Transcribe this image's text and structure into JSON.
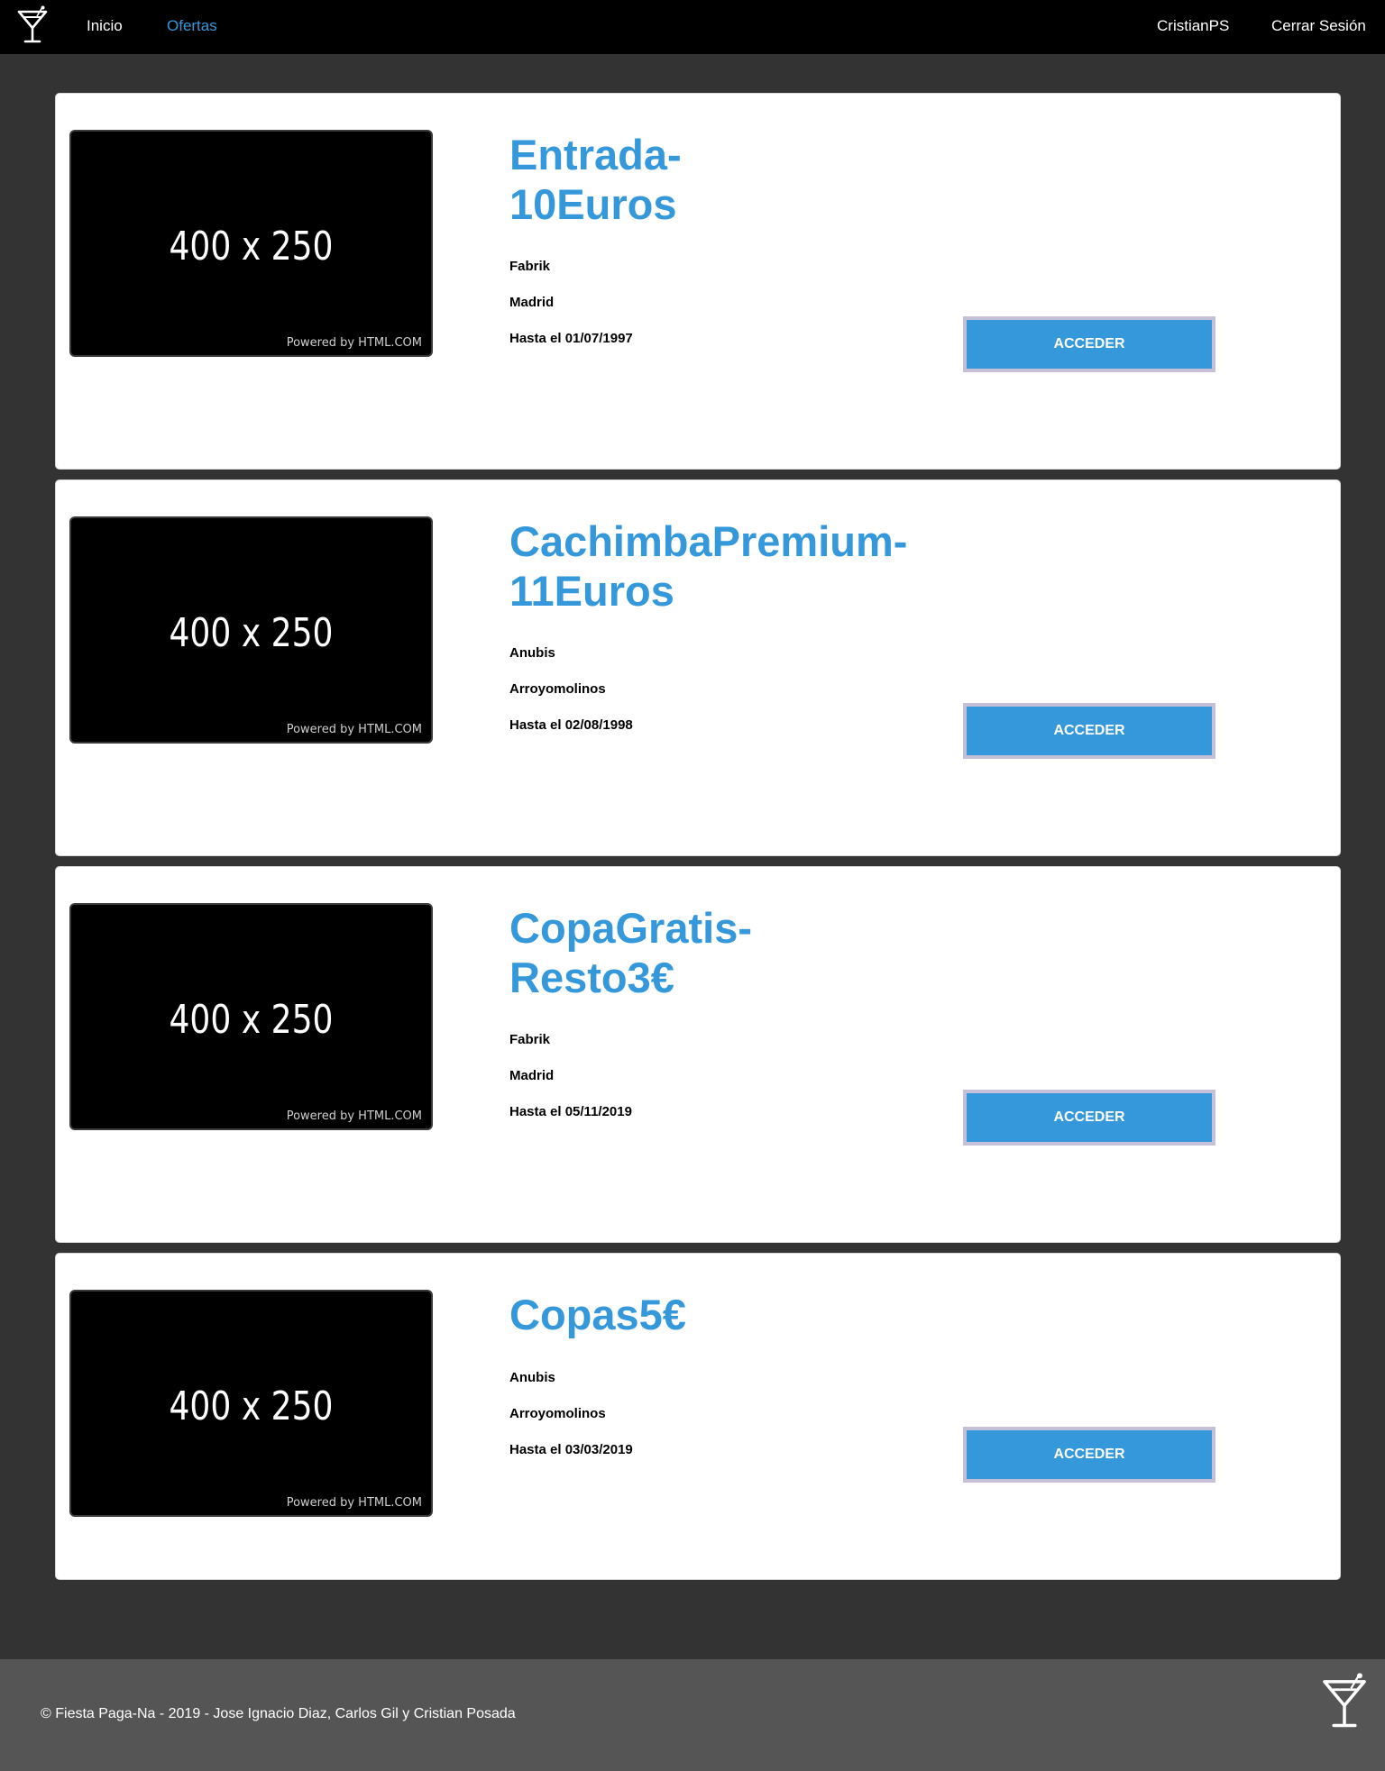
{
  "nav": {
    "logo_icon": "cocktail-glass-icon",
    "links": [
      {
        "label": "Inicio"
      },
      {
        "label": "Ofertas",
        "active": true
      }
    ],
    "user": "CristianPS",
    "logout": "Cerrar Sesión",
    "accent_color": "#3498db"
  },
  "offers": [
    {
      "title": "Entrada-10Euros",
      "image_text": "400 x 250",
      "image_credit": "Powered by HTML.COM",
      "venue": "Fabrik",
      "city": "Madrid",
      "until": "Hasta el 01/07/1997",
      "button": "ACCEDER"
    },
    {
      "title": "CachimbaPremium-11Euros",
      "image_text": "400 x 250",
      "image_credit": "Powered by HTML.COM",
      "venue": "Anubis",
      "city": "Arroyomolinos",
      "until": "Hasta el 02/08/1998",
      "button": "ACCEDER"
    },
    {
      "title": "CopaGratis-Resto3€",
      "image_text": "400 x 250",
      "image_credit": "Powered by HTML.COM",
      "venue": "Fabrik",
      "city": "Madrid",
      "until": "Hasta el 05/11/2019",
      "button": "ACCEDER"
    },
    {
      "title": "Copas5€",
      "image_text": "400 x 250",
      "image_credit": "Powered by HTML.COM",
      "venue": "Anubis",
      "city": "Arroyomolinos",
      "until": "Hasta el 03/03/2019",
      "button": "ACCEDER"
    }
  ],
  "footer": {
    "text": "© Fiesta Paga-Na - 2019 - Jose Ignacio Diaz, Carlos Gil y Cristian Posada",
    "logo_icon": "cocktail-glass-icon"
  }
}
